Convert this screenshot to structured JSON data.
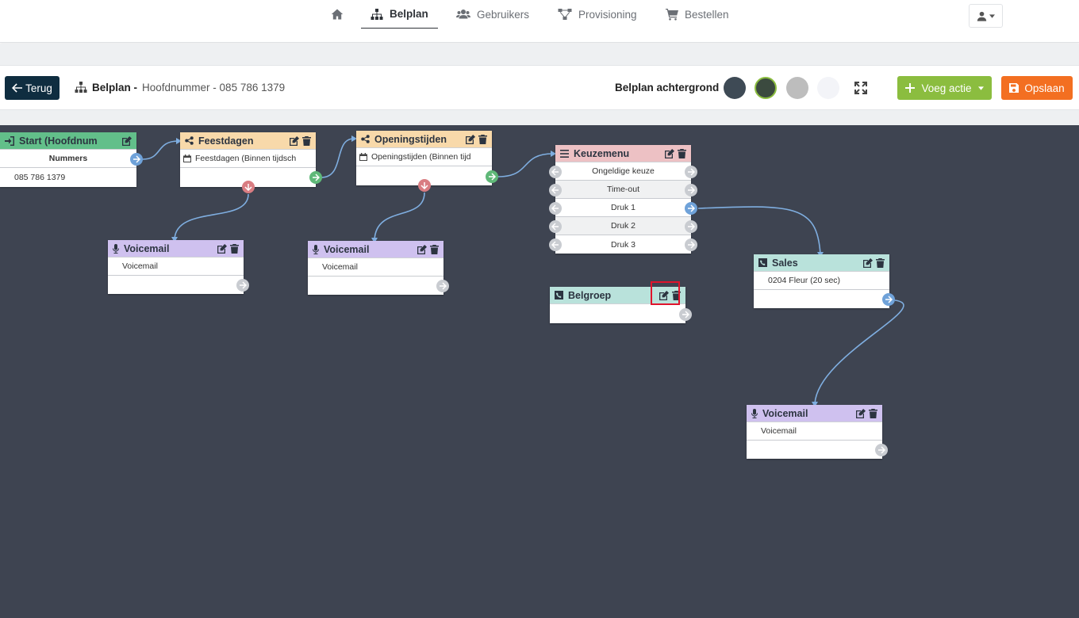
{
  "nav": {
    "home_icon": "home-icon",
    "items": [
      {
        "label": "Belplan",
        "icon": "sitemap-icon"
      },
      {
        "label": "Gebruikers",
        "icon": "users-icon"
      },
      {
        "label": "Provisioning",
        "icon": "network-icon"
      },
      {
        "label": "Bestellen",
        "icon": "cart-icon"
      }
    ],
    "active": "Belplan",
    "user_icon": "user-icon"
  },
  "toolbar": {
    "back_label": "Terug",
    "breadcrumb_bold": "Belplan -",
    "breadcrumb_rest": "Hoofdnummer - 085 786 1379",
    "background_label": "Belplan achtergrond",
    "swatches": [
      "#3e4a55",
      "#3b4a3f",
      "#bdbdbd",
      "#f3f4f8"
    ],
    "add_label": "Voeg actie",
    "save_label": "Opslaan"
  },
  "colors": {
    "canvas": "#3e4451",
    "start_head": "#62bf8a",
    "feestdagen_head": "#f8d9aa",
    "keuzemenu_head": "#edc1c4",
    "voicemail_head": "#cfc1ef",
    "sales_head": "#b9e2db",
    "port_blue": "#6fa2d9",
    "port_green": "#5fb878",
    "port_red": "#d97d82",
    "port_grey": "#c9ccd1"
  },
  "nodes": {
    "start": {
      "title": "Start (Hoofdnum",
      "row1": "Nummers",
      "row2": "085 786 1379"
    },
    "feestdagen": {
      "title": "Feestdagen",
      "row1": "Feestdagen (Binnen tijdsch"
    },
    "openingstijden": {
      "title": "Openingstijden",
      "row1": "Openingstijden (Binnen tijd"
    },
    "keuzemenu": {
      "title": "Keuzemenu",
      "options": [
        "Ongeldige keuze",
        "Time-out",
        "Druk 1",
        "Druk 2",
        "Druk 3"
      ]
    },
    "voicemail1": {
      "title": "Voicemail",
      "row1": "Voicemail"
    },
    "voicemail2": {
      "title": "Voicemail",
      "row1": "Voicemail"
    },
    "belgroep": {
      "title": "Belgroep"
    },
    "sales": {
      "title": "Sales",
      "row1": "0204 Fleur (20 sec)"
    },
    "voicemail3": {
      "title": "Voicemail",
      "row1": "Voicemail"
    }
  }
}
